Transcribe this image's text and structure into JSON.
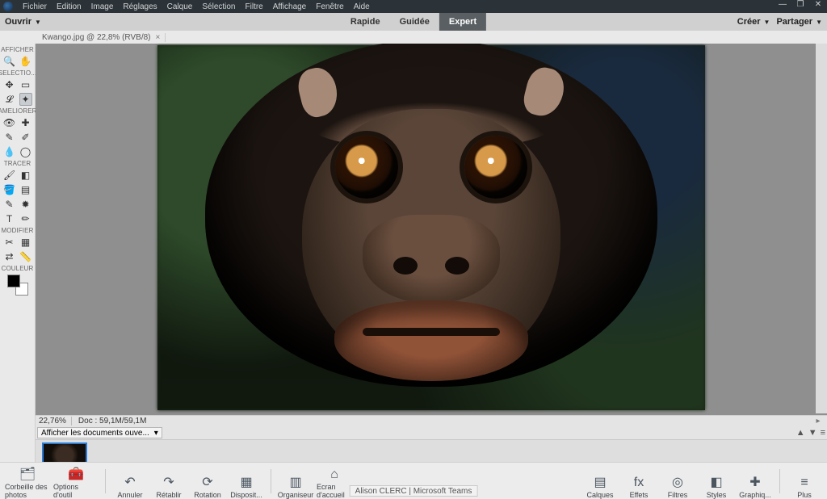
{
  "menubar": {
    "items": [
      "Fichier",
      "Edition",
      "Image",
      "Réglages",
      "Calque",
      "Sélection",
      "Filtre",
      "Affichage",
      "Fenêtre",
      "Aide"
    ]
  },
  "window_controls": {
    "min": "—",
    "max": "❐",
    "close": "✕"
  },
  "toolbar": {
    "open_label": "Ouvrir",
    "modes": {
      "quick": "Rapide",
      "guided": "Guidée",
      "expert": "Expert"
    },
    "create_label": "Créer",
    "share_label": "Partager"
  },
  "document_tab": {
    "title": "Kwango.jpg @ 22,8% (RVB/8)"
  },
  "toolbox": {
    "sections": {
      "afficher": "AFFICHER",
      "selection": "SELECTIO...",
      "ameliorer": "AMELIORER",
      "tracer": "TRACER",
      "modifier": "MODIFIER",
      "couleur": "COULEUR"
    },
    "tool_names": {
      "zoom": "zoom",
      "hand": "hand",
      "move": "move",
      "marquee": "rect-marquee",
      "lasso": "lasso",
      "quick_select": "quick-select",
      "redeye": "red-eye",
      "spot": "spot-heal",
      "whiten": "whiten-teeth",
      "smart": "smart-brush",
      "blur": "blur",
      "sponge": "sponge",
      "brush": "brush",
      "eraser": "eraser",
      "fill": "paint-bucket",
      "gradient": "gradient",
      "picker": "color-picker",
      "shape": "custom-shape",
      "type": "type",
      "pencil": "pencil",
      "crop": "crop",
      "recompose": "recompose",
      "content_move": "content-aware-move",
      "straighten": "straighten"
    }
  },
  "status": {
    "zoom": "22,76%",
    "doc": "Doc : 59,1M/59,1M"
  },
  "doc_dropdown": {
    "label": "Afficher les documents ouve..."
  },
  "bottombar": {
    "left": [
      {
        "id": "photo-bin",
        "label": "Corbeille des photos",
        "icon": "🗂"
      },
      {
        "id": "tool-options",
        "label": "Options d'outil",
        "icon": "🧰"
      },
      {
        "id": "undo",
        "label": "Annuler",
        "icon": "↶"
      },
      {
        "id": "redo",
        "label": "Rétablir",
        "icon": "↷"
      },
      {
        "id": "rotate",
        "label": "Rotation",
        "icon": "⟳"
      },
      {
        "id": "layout",
        "label": "Disposit...",
        "icon": "▦"
      },
      {
        "id": "organizer",
        "label": "Organiseur",
        "icon": "▥"
      },
      {
        "id": "home",
        "label": "Ecran d'accueil",
        "icon": "⌂"
      }
    ],
    "right": [
      {
        "id": "layers",
        "label": "Calques",
        "icon": "▤"
      },
      {
        "id": "effects",
        "label": "Effets",
        "icon": "fx"
      },
      {
        "id": "filters",
        "label": "Filtres",
        "icon": "◎"
      },
      {
        "id": "styles",
        "label": "Styles",
        "icon": "◧"
      },
      {
        "id": "graphics",
        "label": "Graphiq...",
        "icon": "✚"
      },
      {
        "id": "more",
        "label": "Plus",
        "icon": "≡"
      }
    ],
    "user": "Alison CLERC | Microsoft Teams"
  },
  "colors": {
    "accent": "#2a7bd3",
    "active_tab": "#5a5f63"
  }
}
